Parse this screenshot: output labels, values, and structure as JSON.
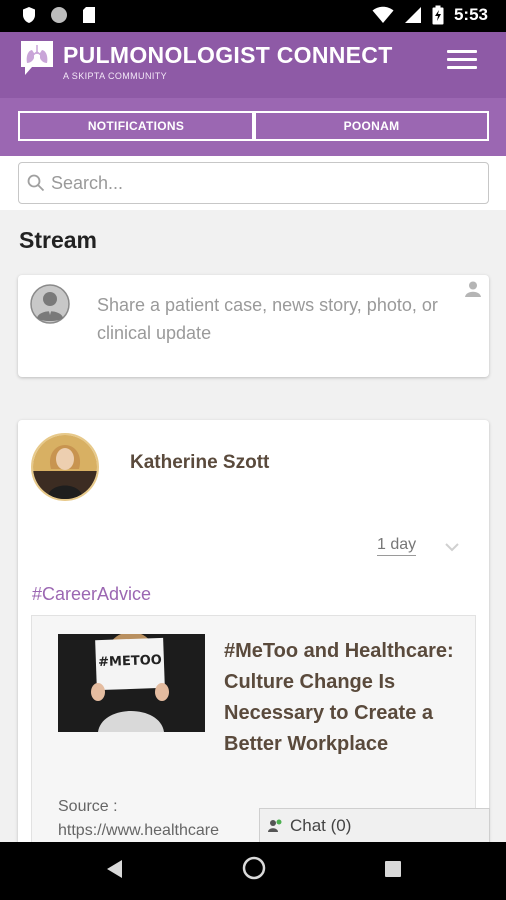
{
  "status_bar": {
    "time": "5:53",
    "icons": [
      "shield-icon",
      "circle-icon",
      "sd-card-icon",
      "wifi-icon",
      "signal-icon",
      "battery-charging-icon"
    ]
  },
  "header": {
    "brand_title": "PULMONOLOGIST CONNECT",
    "brand_subtitle": "A SKIPTA COMMUNITY",
    "logo_icon": "lungs-logo-icon",
    "menu_icon": "hamburger-menu-icon",
    "background_color": "#8e5aa6"
  },
  "tabs": [
    {
      "label": "NOTIFICATIONS"
    },
    {
      "label": "POONAM"
    }
  ],
  "search": {
    "placeholder": "Search...",
    "value": ""
  },
  "stream": {
    "title": "Stream",
    "composer_placeholder": "Share a patient case, news story, photo, or clinical update"
  },
  "post": {
    "author": "Katherine Szott",
    "time": "1 day",
    "tag": "#CareerAdvice",
    "article": {
      "image_text": "#METOO",
      "title": "#MeToo and Healthcare: Culture Change Is Necessary to Create a Better Workplace",
      "source_label": "Source :",
      "source_url": "https://www.healthcare"
    }
  },
  "chat": {
    "label": "Chat (0)"
  },
  "colors": {
    "accent": "#9b67b2",
    "author_text": "#5a4a3c"
  }
}
